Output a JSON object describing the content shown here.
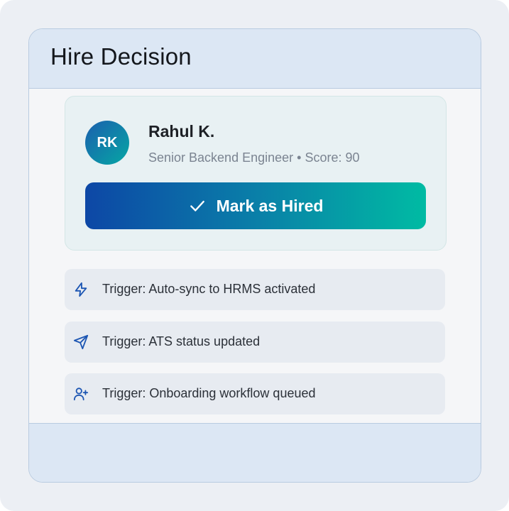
{
  "header": {
    "title": "Hire Decision"
  },
  "candidate": {
    "initials": "RK",
    "name": "Rahul K.",
    "subtitle": "Senior Backend Engineer • Score: 90",
    "hire_button_label": "Mark as Hired"
  },
  "triggers": [
    {
      "icon": "lightning-icon",
      "label": "Trigger: Auto-sync to HRMS activated"
    },
    {
      "icon": "send-icon",
      "label": "Trigger: ATS status updated"
    },
    {
      "icon": "user-plus-icon",
      "label": "Trigger: Onboarding workflow queued"
    }
  ],
  "colors": {
    "accent_start": "#0d47a6",
    "accent_end": "#00bba3",
    "icon": "#1d56b3"
  }
}
